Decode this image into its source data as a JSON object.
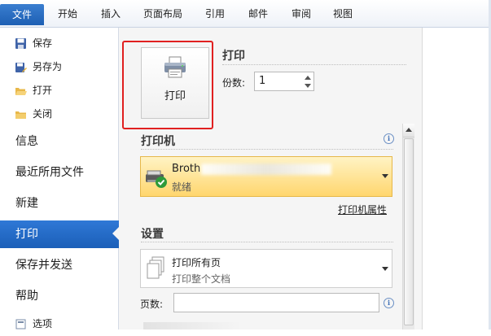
{
  "ribbon": {
    "file_tab": "文件",
    "tabs": [
      "开始",
      "插入",
      "页面布局",
      "引用",
      "邮件",
      "审阅",
      "视图"
    ]
  },
  "sidebar": {
    "small_items": [
      {
        "label": "保存",
        "icon": "save-icon"
      },
      {
        "label": "另存为",
        "icon": "save-as-icon"
      },
      {
        "label": "打开",
        "icon": "open-folder-icon"
      },
      {
        "label": "关闭",
        "icon": "close-folder-icon"
      }
    ],
    "big_items": [
      "信息",
      "最近所用文件",
      "新建",
      "打印",
      "保存并发送",
      "帮助"
    ],
    "active_item": "打印",
    "options_label": "选项"
  },
  "print": {
    "section_title": "打印",
    "button_label": "打印",
    "copies_label": "份数:",
    "copies_value": "1"
  },
  "printer": {
    "section_title": "打印机",
    "name": "Broth",
    "status": "就绪",
    "properties_link": "打印机属性"
  },
  "settings": {
    "section_title": "设置",
    "print_range_main": "打印所有页",
    "print_range_sub": "打印整个文档",
    "pages_label": "页数:",
    "pages_value": ""
  },
  "colors": {
    "accent": "#1b5fb8",
    "highlight_border": "#e02020",
    "printer_dropdown_bg": "#ffd66e"
  }
}
